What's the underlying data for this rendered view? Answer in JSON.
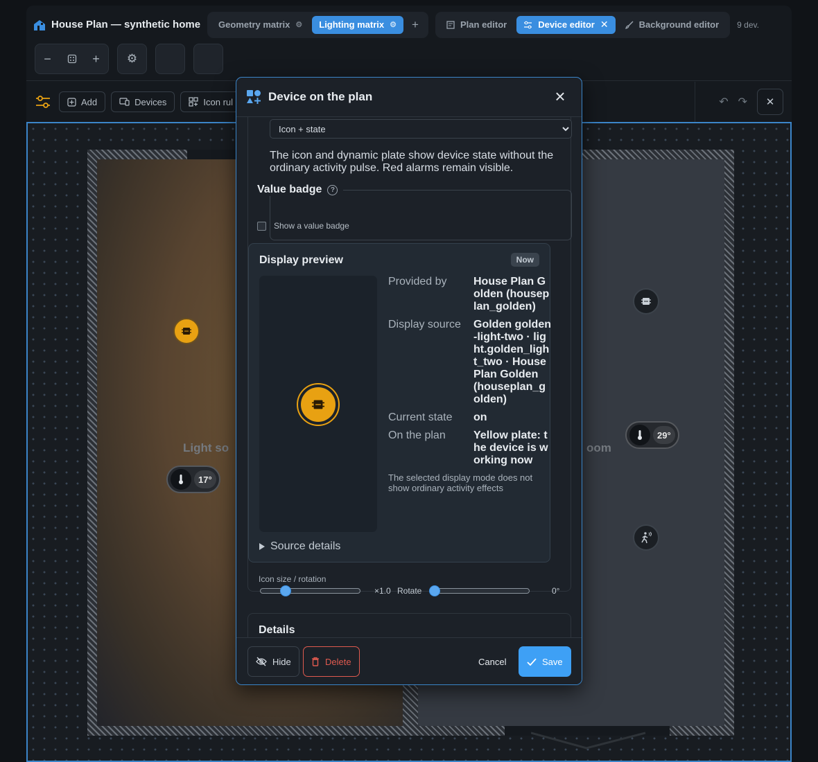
{
  "app": {
    "title": "House Plan — synthetic home"
  },
  "matrix_tabs": [
    {
      "label": "Geometry matrix",
      "active": false
    },
    {
      "label": "Lighting matrix",
      "active": true
    }
  ],
  "editor_tabs": [
    {
      "label": "Plan editor",
      "active": false
    },
    {
      "label": "Device editor",
      "active": true
    },
    {
      "label": "Background editor",
      "active": false
    }
  ],
  "device_count": "9 dev.",
  "toolbar2": {
    "add": "Add",
    "devices": "Devices",
    "icon_rules": "Icon rul"
  },
  "plan": {
    "room_left_label": "Light so",
    "room_right_label": "oom",
    "badges": [
      {
        "value": "17°"
      },
      {
        "value": "29°"
      }
    ]
  },
  "modal": {
    "title": "Device on the plan",
    "display_mode": {
      "selected": "Icon + state"
    },
    "description": "The icon and dynamic plate show device state without the ordinary activity pulse. Red alarms remain visible.",
    "value_badge": {
      "legend": "Value badge",
      "checkbox_label": "Show a value badge",
      "checked": false
    },
    "preview": {
      "title": "Display preview",
      "badge": "Now",
      "rows": [
        {
          "key": "Provided by",
          "value": "House Plan Golden (houseplan_golden)"
        },
        {
          "key": "Display source",
          "value": "Golden golden-light-two · light.golden_light_two · House Plan Golden (houseplan_golden)"
        },
        {
          "key": "Current state",
          "value": "on"
        },
        {
          "key": "On the plan",
          "value": "Yellow plate: the device is working now"
        }
      ],
      "note": "The selected display mode does not show ordinary activity effects",
      "source_details": "Source details"
    },
    "size_rotation": {
      "label": "Icon size / rotation",
      "scale_text": "×1.0",
      "rotate_label": "Rotate",
      "rotate_text": "0°",
      "scale": 1.0,
      "rotate": 0
    },
    "details_title": "Details",
    "footer": {
      "hide": "Hide",
      "delete": "Delete",
      "cancel": "Cancel",
      "save": "Save"
    }
  },
  "colors": {
    "accent": "#3a8ee0",
    "device_on": "#e8a112",
    "danger": "#e05a4f"
  }
}
